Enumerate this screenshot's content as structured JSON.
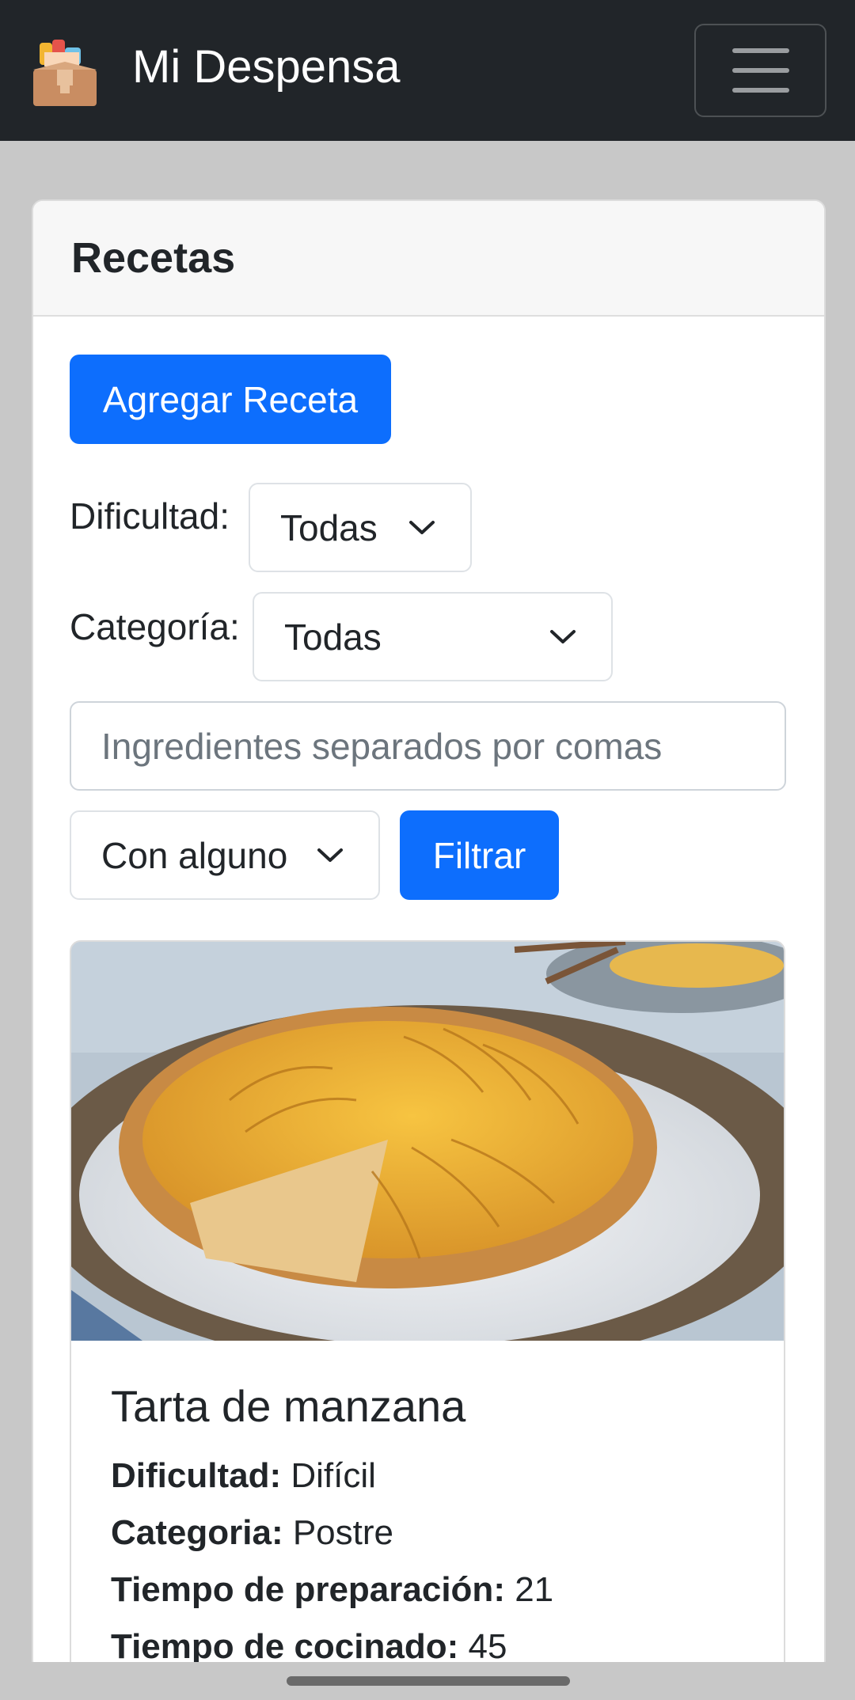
{
  "navbar": {
    "brand": "Mi Despensa",
    "logo_icon": "pantry-box-icon",
    "menu_icon": "hamburger-menu-icon"
  },
  "page": {
    "title": "Recetas",
    "add_button": "Agregar Receta"
  },
  "filters": {
    "difficulty_label": "Dificultad:",
    "difficulty_value": "Todas",
    "category_label": "Categoría:",
    "category_value": "Todas",
    "ingredients_placeholder": "Ingredientes separados por comas",
    "match_mode_value": "Con alguno",
    "filter_button": "Filtrar"
  },
  "recipes": [
    {
      "title": "Tarta de manzana",
      "image_icon": "apple-tart-photo",
      "difficulty_label": "Dificultad:",
      "difficulty": "Difícil",
      "category_label": "Categoria:",
      "category": "Postre",
      "prep_label": "Tiempo de preparación:",
      "prep_time": "21",
      "cook_label": "Tiempo de cocinado:",
      "cook_time": "45"
    }
  ],
  "colors": {
    "navbar_bg": "#212529",
    "primary": "#0d6efd",
    "page_bg": "#c8c8c8"
  }
}
